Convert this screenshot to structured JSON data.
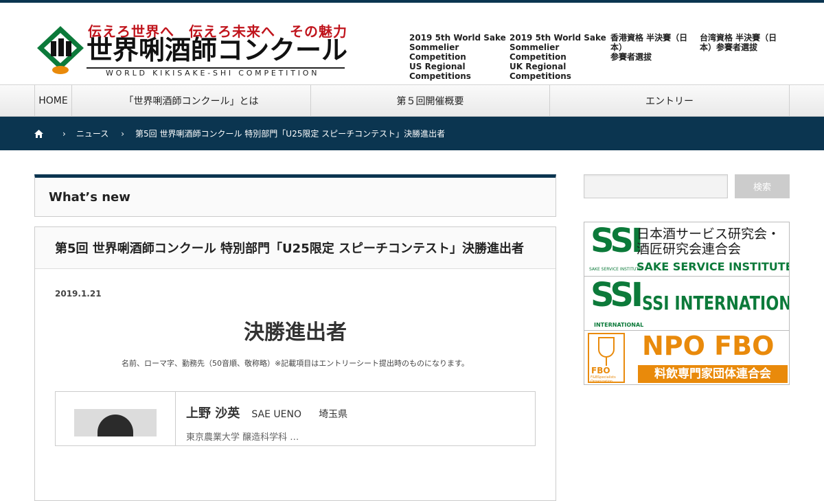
{
  "header": {
    "logo_tagline": "伝えろ世界へ　伝えろ未来へ　その魅力",
    "logo_title": "世界唎酒師コンクール",
    "logo_subtitle": "WORLD KIKISAKE-SHI COMPETITION",
    "links": [
      "2019 5th World Sake\nSommelier\nCompetition\nUS Regional\nCompetitions",
      "2019 5th World Sake\nSommelier\nCompetition\nUK Regional\nCompetitions",
      "香港資格 半決賽（日\n本）\n参賽者選拔",
      "台湾資格 半決賽（日\n本）参賽者選拔"
    ]
  },
  "nav": [
    "HOME",
    "「世界唎酒師コンクール」とは",
    "第５回開催概要",
    "エントリー"
  ],
  "breadcrumb": {
    "items": [
      "ニュース",
      "第5回 世界唎酒師コンクール 特別部門「U25限定 スピーチコンテスト」決勝進出者"
    ]
  },
  "main": {
    "section_title": "What’s new",
    "article_title": "第5回 世界唎酒師コンクール 特別部門「U25限定 スピーチコンテスト」決勝進出者",
    "date": "2019.1.21",
    "heading": "決勝進出者",
    "note": "名前、ローマ字、勤務先（50音順、敬称略）※記載項目はエントリーシート提出時のものになります。",
    "finalist": {
      "name": "上野 沙英",
      "romaji": "SAE UENO",
      "prefecture": "埼玉県",
      "school": "東京農業大学 醸造科学科 …"
    }
  },
  "sidebar": {
    "search_button": "検索",
    "banners": {
      "ssi": {
        "mark": "SSI",
        "mark_sub": "SAKE SERVICE INSTITUTE",
        "jp": "日本酒サービス研究会・\n酒匠研究会連合会",
        "en": "SAKE SERVICE INSTITUTE"
      },
      "ssi_international": {
        "mark": "SSI",
        "mark_sub": "INTERNATIONAL",
        "text": "SSI INTERNATIONAL"
      },
      "fbo": {
        "mark_label": "FBO",
        "mark_sub": "F&BSpecialists\nOrganization",
        "title": "NPO FBO",
        "bar": "料飲専門家団体連合会"
      }
    }
  },
  "colors": {
    "navy": "#0b3550",
    "logo_red": "#c0141c",
    "ssi_green": "#0c7a3a",
    "fbo_orange": "#e98a0b"
  }
}
